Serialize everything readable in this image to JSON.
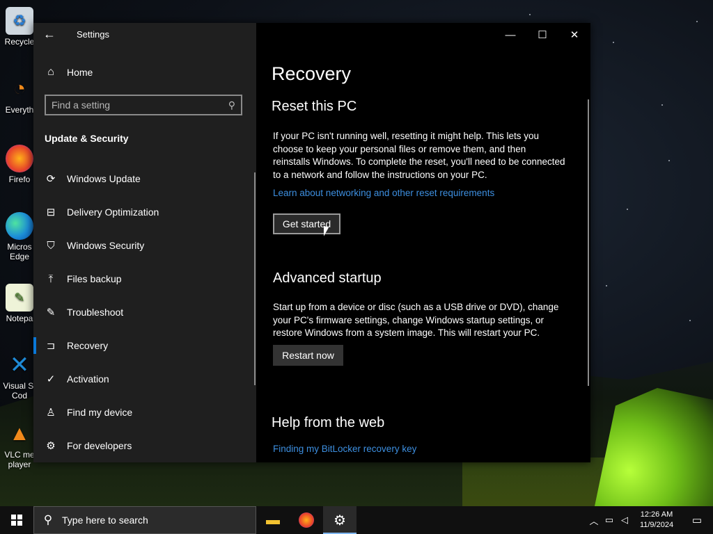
{
  "desktop": {
    "icons": [
      {
        "label": "Recycle",
        "icon": "recycle-bin-icon"
      },
      {
        "label": "Everyth",
        "icon": "everything-icon"
      },
      {
        "label": "Firefo",
        "icon": "firefox-icon"
      },
      {
        "label": "Micros Edge",
        "icon": "edge-icon"
      },
      {
        "label": "Notepa",
        "icon": "notepad-icon"
      },
      {
        "label": "Visual St Cod",
        "icon": "vscode-icon"
      },
      {
        "label": "VLC me player",
        "icon": "vlc-icon"
      }
    ]
  },
  "window": {
    "title": "Settings",
    "controls": {
      "minimize": "—",
      "maximize": "☐",
      "close": "✕"
    }
  },
  "sidebar": {
    "home_label": "Home",
    "search_placeholder": "Find a setting",
    "section_title": "Update & Security",
    "items": [
      {
        "label": "Windows Update",
        "icon": "refresh-icon",
        "active": false
      },
      {
        "label": "Delivery Optimization",
        "icon": "delivery-icon",
        "active": false
      },
      {
        "label": "Windows Security",
        "icon": "shield-icon",
        "active": false
      },
      {
        "label": "Files backup",
        "icon": "backup-icon",
        "active": false
      },
      {
        "label": "Troubleshoot",
        "icon": "wrench-icon",
        "active": false
      },
      {
        "label": "Recovery",
        "icon": "recovery-icon",
        "active": true
      },
      {
        "label": "Activation",
        "icon": "check-circle-icon",
        "active": false
      },
      {
        "label": "Find my device",
        "icon": "find-device-icon",
        "active": false
      },
      {
        "label": "For developers",
        "icon": "developer-icon",
        "active": false
      }
    ]
  },
  "main": {
    "page_title": "Recovery",
    "reset": {
      "heading": "Reset this PC",
      "description": "If your PC isn't running well, resetting it might help. This lets you choose to keep your personal files or remove them, and then reinstalls Windows. To complete the reset, you'll need to be connected to a network and follow the instructions on your PC.",
      "link": "Learn about networking and other reset requirements",
      "button": "Get started"
    },
    "advanced": {
      "heading": "Advanced startup",
      "description": "Start up from a device or disc (such as a USB drive or DVD), change your PC's firmware settings, change Windows startup settings, or restore Windows from a system image. This will restart your PC.",
      "button": "Restart now"
    },
    "help": {
      "heading": "Help from the web",
      "link": "Finding my BitLocker recovery key"
    }
  },
  "taskbar": {
    "search_placeholder": "Type here to search",
    "time": "12:26 AM",
    "date": "11/9/2024"
  },
  "colors": {
    "accent": "#0a78d7",
    "link": "#3d8fe0"
  }
}
